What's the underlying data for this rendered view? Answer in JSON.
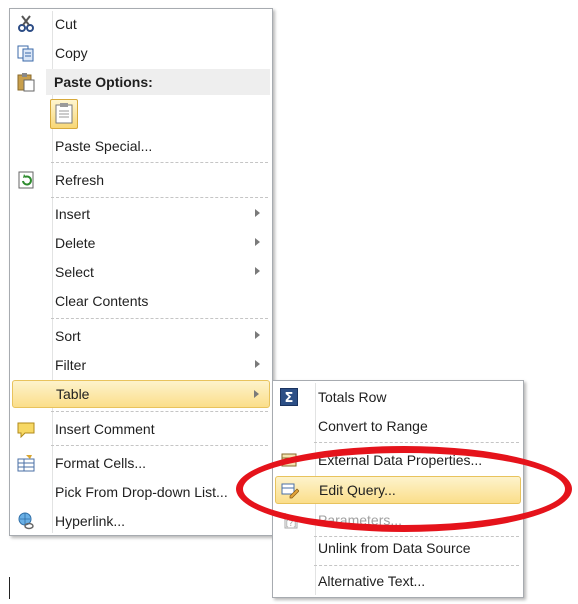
{
  "main_menu": {
    "cut": "Cut",
    "copy": "Copy",
    "paste_options_header": "Paste Options:",
    "paste_special": "Paste Special...",
    "refresh": "Refresh",
    "insert": "Insert",
    "delete": "Delete",
    "select": "Select",
    "clear_contents": "Clear Contents",
    "sort": "Sort",
    "filter": "Filter",
    "table": "Table",
    "insert_comment": "Insert Comment",
    "format_cells": "Format Cells...",
    "pick_from_dropdown": "Pick From Drop-down List...",
    "hyperlink": "Hyperlink..."
  },
  "table_submenu": {
    "totals_row": "Totals Row",
    "convert_to_range": "Convert to Range",
    "external_data_properties": "External Data Properties...",
    "edit_query": "Edit Query...",
    "parameters": "Parameters...",
    "unlink_from_data_source": "Unlink from Data Source",
    "alternative_text": "Alternative Text..."
  },
  "icons": {
    "cut": "scissors-icon",
    "copy": "copy-icon",
    "paste": "paste-icon",
    "refresh": "refresh-icon",
    "comment": "comment-icon",
    "format_cells": "format-cells-icon",
    "hyperlink": "hyperlink-icon",
    "totals": "sigma-icon",
    "external_data": "external-data-icon",
    "edit_query": "edit-query-icon",
    "parameters": "parameters-icon"
  },
  "colors": {
    "highlight": "#fbde8a",
    "annotation_ring": "#e5131b"
  }
}
